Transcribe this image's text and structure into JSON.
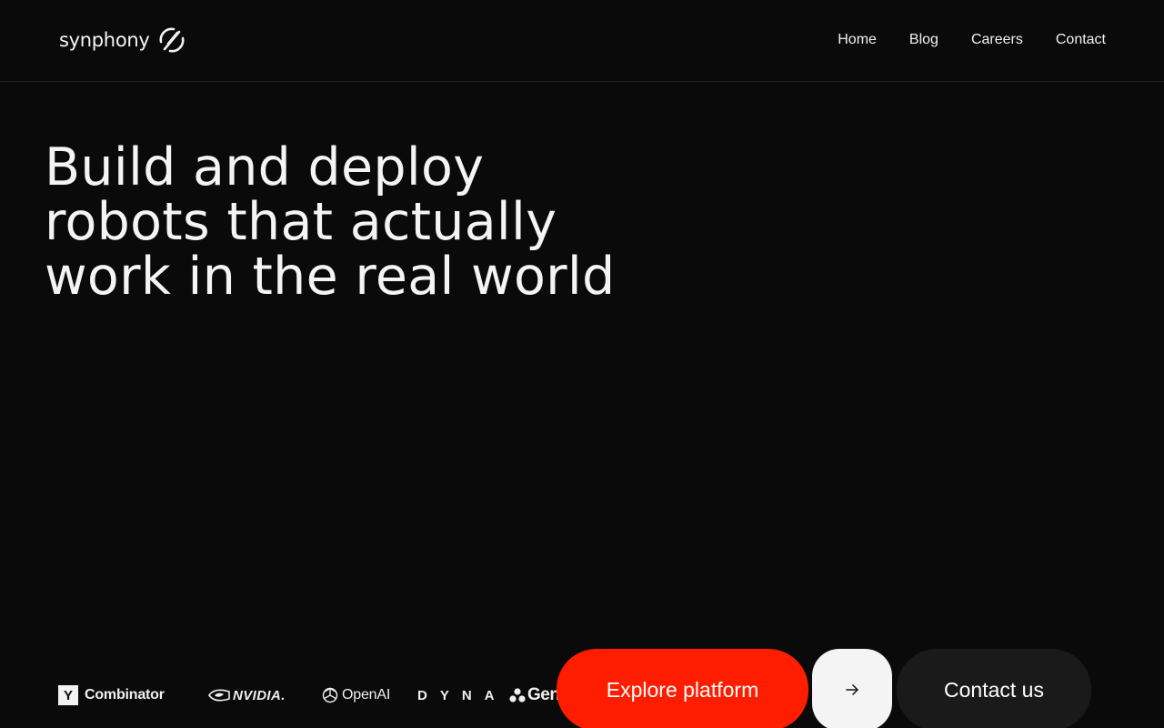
{
  "brand": {
    "name": "synphony",
    "logo_icon": "swirl-logo-icon"
  },
  "nav": {
    "items": [
      {
        "label": "Home"
      },
      {
        "label": "Blog"
      },
      {
        "label": "Careers"
      },
      {
        "label": "Contact"
      }
    ]
  },
  "hero": {
    "title_lines": [
      "Build and deploy",
      "robots that actually",
      "work in the real world"
    ]
  },
  "partners": {
    "ycombinator": {
      "mark": "Y",
      "name": "Combinator"
    },
    "nvidia": {
      "name": "NVIDIA."
    },
    "openai": {
      "name": "OpenAI"
    },
    "dyna": {
      "name": "DYNA"
    },
    "gem": {
      "name": "Gen"
    }
  },
  "cta": {
    "explore_label": "Explore platform",
    "arrow_icon": "arrow-right-icon",
    "contact_label": "Contact us"
  },
  "colors": {
    "background": "#0a0a0a",
    "accent": "#ff1d00",
    "text": "#f2f2f2"
  }
}
